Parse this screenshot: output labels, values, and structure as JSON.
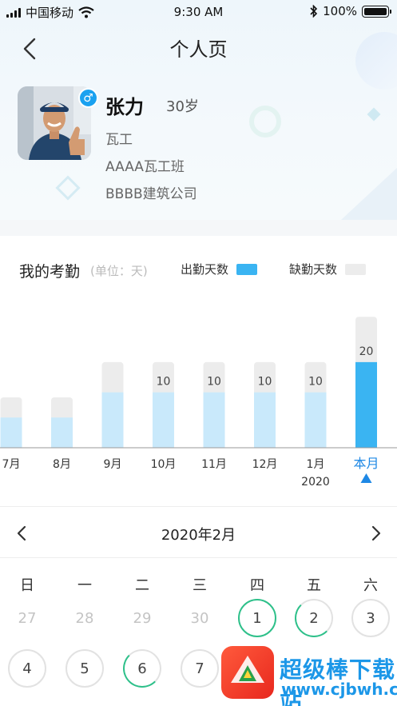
{
  "status_bar": {
    "carrier": "中国移动",
    "time": "9:30 AM",
    "battery": "100%"
  },
  "nav": {
    "title": "个人页"
  },
  "profile": {
    "name": "张力",
    "age": "30岁",
    "gender_symbol": "♂",
    "trade": "瓦工",
    "team": "AAAA瓦工班",
    "company": "BBBB建筑公司"
  },
  "attendance": {
    "title": "我的考勤",
    "unit": "(单位：天)",
    "legend_present": "出勤天数",
    "legend_absent": "缺勤天数",
    "colors": {
      "present": "#c9e9fb",
      "present_current": "#3ab4f2",
      "absent": "#ececec",
      "accent": "#1e88e5"
    }
  },
  "chart_data": {
    "type": "bar",
    "categories": [
      "7月",
      "8月",
      "9月",
      "10月",
      "11月",
      "12月",
      "1月",
      "本月"
    ],
    "sublabels": [
      "",
      "",
      "",
      "",
      "",
      "",
      "2020",
      ""
    ],
    "series": [
      {
        "name": "出勤天数",
        "values": [
          6,
          6,
          11,
          11,
          11,
          11,
          11,
          17
        ]
      },
      {
        "name": "缺勤天数",
        "values": [
          4,
          4,
          6,
          6,
          6,
          6,
          6,
          9
        ]
      }
    ],
    "value_labels": [
      "",
      "",
      "",
      "10",
      "10",
      "10",
      "10",
      "20"
    ],
    "current_index": 7
  },
  "calendar": {
    "month_title": "2020年2月",
    "weekdays": [
      "日",
      "一",
      "二",
      "三",
      "四",
      "五",
      "六"
    ],
    "rows": [
      [
        {
          "d": "27",
          "state": "other"
        },
        {
          "d": "28",
          "state": "other"
        },
        {
          "d": "29",
          "state": "other"
        },
        {
          "d": "30",
          "state": "other"
        },
        {
          "d": "1",
          "state": "present"
        },
        {
          "d": "2",
          "state": "partial"
        },
        {
          "d": "3",
          "state": "absent"
        }
      ],
      [
        {
          "d": "4",
          "state": "absent"
        },
        {
          "d": "5",
          "state": "absent"
        },
        {
          "d": "6",
          "state": "partial"
        },
        {
          "d": "7",
          "state": "absent"
        }
      ]
    ]
  },
  "watermark": {
    "title": "超级棒下载站",
    "url": "www.cjbwh.com"
  }
}
